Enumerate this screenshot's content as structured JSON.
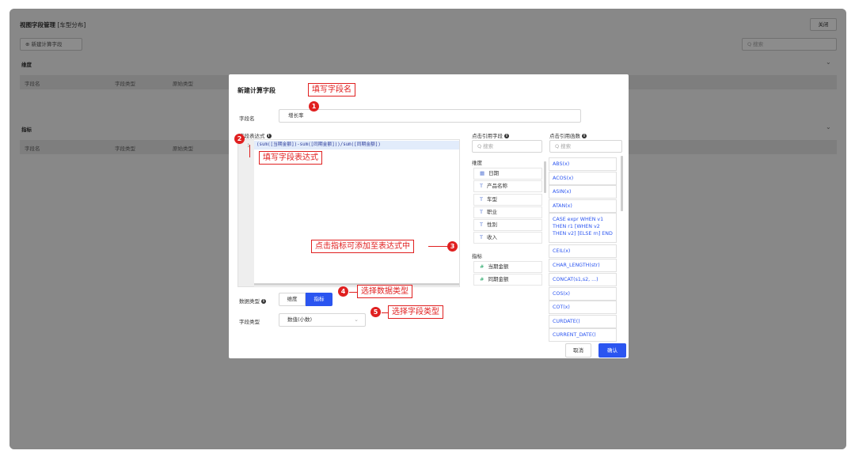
{
  "background": {
    "title": "视图字段管理",
    "subtitle": "[车型分布]",
    "close_label": "关闭",
    "new_button_label": "⊕ 新建计算字段",
    "search_placeholder": "Q 搜索",
    "section_dim": "维度",
    "section_metric": "指标",
    "columns": [
      "字段名",
      "字段类型",
      "原始类型"
    ]
  },
  "dialog": {
    "title": "新建计算字段",
    "name_label": "字段名",
    "name_value": "增长率",
    "expr_label": "字段表达式",
    "expr_line_no": "1",
    "expression": "(sum([当期金额])-sum([同期金额]))/sum([同期金额])",
    "data_type_label": "数据类型",
    "data_type_options": [
      "维度",
      "指标"
    ],
    "data_type_selected": "指标",
    "field_type_label": "字段类型",
    "field_type_value": "数值(小数)",
    "fields_header": "点击引用字段",
    "functions_header": "点击引用函数",
    "search_placeholder": "Q 搜索",
    "dimension_group": "维度",
    "dimensions": [
      {
        "icon": "calendar-icon",
        "label": "日期"
      },
      {
        "icon": "text-type-icon",
        "label": "产品名称"
      },
      {
        "icon": "text-type-icon",
        "label": "车型"
      },
      {
        "icon": "text-type-icon",
        "label": "职业"
      },
      {
        "icon": "text-type-icon",
        "label": "性别"
      },
      {
        "icon": "text-type-icon",
        "label": "收入"
      }
    ],
    "metric_group": "指标",
    "metrics": [
      {
        "icon": "number-type-icon",
        "label": "当期金额"
      },
      {
        "icon": "number-type-icon",
        "label": "同期金额"
      }
    ],
    "functions": [
      "ABS(x)",
      "ACOS(x)",
      "ASIN(x)",
      "ATAN(x)",
      "CASE expr WHEN v1 THEN r1 [WHEN v2 THEN v2] [ELSE rn] END",
      "CEIL(x)",
      "CHAR_LENGTH(str)",
      "CONCAT(s1,s2, ...)",
      "COS(x)",
      "COT(x)",
      "CURDATE()",
      "CURRENT_DATE()"
    ],
    "cancel_label": "取消",
    "confirm_label": "确认"
  },
  "annotations": [
    {
      "number": "1",
      "text": "填写字段名"
    },
    {
      "number": "2",
      "text": "填写字段表达式"
    },
    {
      "number": "3",
      "text": "点击指标可添加至表达式中"
    },
    {
      "number": "4",
      "text": "选择数据类型"
    },
    {
      "number": "5",
      "text": "选择字段类型"
    }
  ],
  "colors": {
    "accent": "#2b55f0",
    "annotation": "#e02020"
  }
}
